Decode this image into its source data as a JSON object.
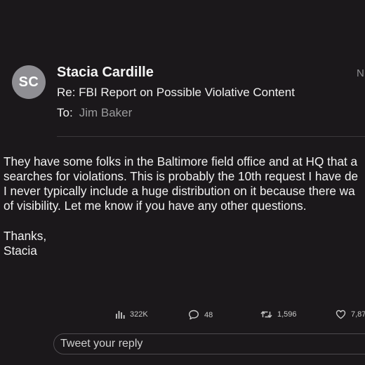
{
  "email": {
    "avatar_initials": "SC",
    "sender": "Stacia Cardille",
    "subject": "Re: FBI Report on Possible Violative Content",
    "to_label": "To:",
    "to_name": "Jim Baker",
    "date_fragment": "N",
    "body_lines": [
      "They have some folks in the Baltimore field office and at HQ that a",
      "searches for violations. This is probably the 10th request I have de",
      "I never typically include a huge distribution on it because there wa",
      "of visibility. Let me know if you have any other questions."
    ],
    "signoff_lines": [
      "Thanks,",
      "Stacia"
    ]
  },
  "tweet_actions": {
    "views": {
      "icon": "views-chart-icon",
      "count": "322K"
    },
    "replies": {
      "icon": "comment-icon",
      "count": "48"
    },
    "retweets": {
      "icon": "retweet-icon",
      "count": "1,596"
    },
    "likes": {
      "icon": "heart-icon",
      "count": "7,87"
    }
  },
  "reply_box": {
    "placeholder": "Tweet your reply"
  }
}
